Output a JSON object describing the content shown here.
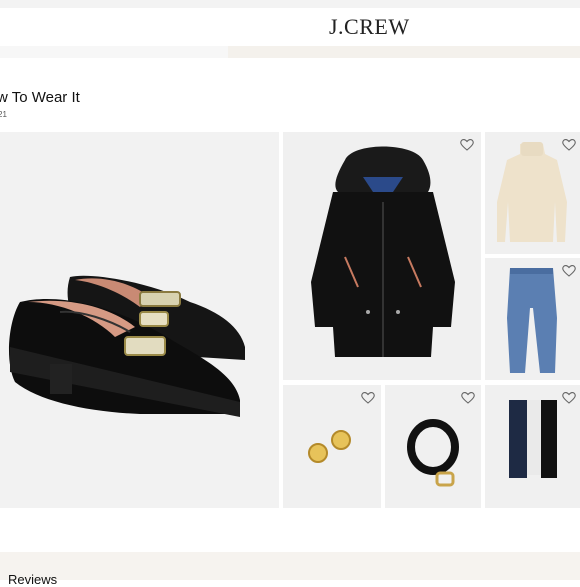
{
  "header": {
    "brand": "J.CREW"
  },
  "section": {
    "title": "w To Wear It",
    "subtitle": "21"
  },
  "products": [
    {
      "icon": "loafers-icon",
      "heart": "heart-icon"
    },
    {
      "icon": "parka-coat-icon",
      "heart": "heart-icon"
    },
    {
      "icon": "turtleneck-sweater-icon",
      "heart": "heart-icon"
    },
    {
      "icon": "jeans-icon",
      "heart": "heart-icon"
    },
    {
      "icon": "gold-earrings-icon",
      "heart": "heart-icon"
    },
    {
      "icon": "black-belt-icon",
      "heart": "heart-icon"
    },
    {
      "icon": "socks-icon",
      "heart": "heart-icon"
    }
  ],
  "footer": {
    "reviews_label": "Reviews"
  },
  "colors": {
    "tile_bg": "#f0f0f0",
    "band_bg": "#f4f1ec"
  }
}
